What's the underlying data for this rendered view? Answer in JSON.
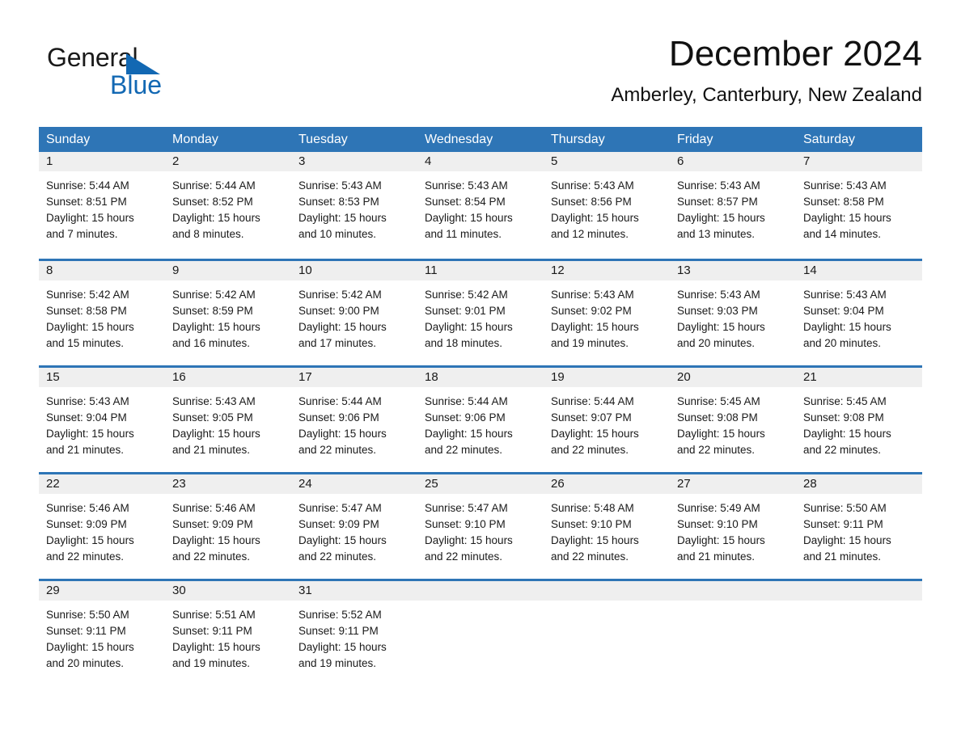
{
  "brand": {
    "name_part1": "General",
    "name_part2": "Blue",
    "logo_icon": "triangle-flag-icon",
    "accent_color": "#1268b3"
  },
  "header": {
    "title": "December 2024",
    "subtitle": "Amberley, Canterbury, New Zealand"
  },
  "theme": {
    "header_blue": "#2e75b6",
    "daynum_band": "#efefef",
    "text": "#1a1a1a"
  },
  "weekdays": [
    "Sunday",
    "Monday",
    "Tuesday",
    "Wednesday",
    "Thursday",
    "Friday",
    "Saturday"
  ],
  "weeks": [
    [
      {
        "day": "1",
        "sunrise": "Sunrise: 5:44 AM",
        "sunset": "Sunset: 8:51 PM",
        "daylight_line1": "Daylight: 15 hours",
        "daylight_line2": "and 7 minutes."
      },
      {
        "day": "2",
        "sunrise": "Sunrise: 5:44 AM",
        "sunset": "Sunset: 8:52 PM",
        "daylight_line1": "Daylight: 15 hours",
        "daylight_line2": "and 8 minutes."
      },
      {
        "day": "3",
        "sunrise": "Sunrise: 5:43 AM",
        "sunset": "Sunset: 8:53 PM",
        "daylight_line1": "Daylight: 15 hours",
        "daylight_line2": "and 10 minutes."
      },
      {
        "day": "4",
        "sunrise": "Sunrise: 5:43 AM",
        "sunset": "Sunset: 8:54 PM",
        "daylight_line1": "Daylight: 15 hours",
        "daylight_line2": "and 11 minutes."
      },
      {
        "day": "5",
        "sunrise": "Sunrise: 5:43 AM",
        "sunset": "Sunset: 8:56 PM",
        "daylight_line1": "Daylight: 15 hours",
        "daylight_line2": "and 12 minutes."
      },
      {
        "day": "6",
        "sunrise": "Sunrise: 5:43 AM",
        "sunset": "Sunset: 8:57 PM",
        "daylight_line1": "Daylight: 15 hours",
        "daylight_line2": "and 13 minutes."
      },
      {
        "day": "7",
        "sunrise": "Sunrise: 5:43 AM",
        "sunset": "Sunset: 8:58 PM",
        "daylight_line1": "Daylight: 15 hours",
        "daylight_line2": "and 14 minutes."
      }
    ],
    [
      {
        "day": "8",
        "sunrise": "Sunrise: 5:42 AM",
        "sunset": "Sunset: 8:58 PM",
        "daylight_line1": "Daylight: 15 hours",
        "daylight_line2": "and 15 minutes."
      },
      {
        "day": "9",
        "sunrise": "Sunrise: 5:42 AM",
        "sunset": "Sunset: 8:59 PM",
        "daylight_line1": "Daylight: 15 hours",
        "daylight_line2": "and 16 minutes."
      },
      {
        "day": "10",
        "sunrise": "Sunrise: 5:42 AM",
        "sunset": "Sunset: 9:00 PM",
        "daylight_line1": "Daylight: 15 hours",
        "daylight_line2": "and 17 minutes."
      },
      {
        "day": "11",
        "sunrise": "Sunrise: 5:42 AM",
        "sunset": "Sunset: 9:01 PM",
        "daylight_line1": "Daylight: 15 hours",
        "daylight_line2": "and 18 minutes."
      },
      {
        "day": "12",
        "sunrise": "Sunrise: 5:43 AM",
        "sunset": "Sunset: 9:02 PM",
        "daylight_line1": "Daylight: 15 hours",
        "daylight_line2": "and 19 minutes."
      },
      {
        "day": "13",
        "sunrise": "Sunrise: 5:43 AM",
        "sunset": "Sunset: 9:03 PM",
        "daylight_line1": "Daylight: 15 hours",
        "daylight_line2": "and 20 minutes."
      },
      {
        "day": "14",
        "sunrise": "Sunrise: 5:43 AM",
        "sunset": "Sunset: 9:04 PM",
        "daylight_line1": "Daylight: 15 hours",
        "daylight_line2": "and 20 minutes."
      }
    ],
    [
      {
        "day": "15",
        "sunrise": "Sunrise: 5:43 AM",
        "sunset": "Sunset: 9:04 PM",
        "daylight_line1": "Daylight: 15 hours",
        "daylight_line2": "and 21 minutes."
      },
      {
        "day": "16",
        "sunrise": "Sunrise: 5:43 AM",
        "sunset": "Sunset: 9:05 PM",
        "daylight_line1": "Daylight: 15 hours",
        "daylight_line2": "and 21 minutes."
      },
      {
        "day": "17",
        "sunrise": "Sunrise: 5:44 AM",
        "sunset": "Sunset: 9:06 PM",
        "daylight_line1": "Daylight: 15 hours",
        "daylight_line2": "and 22 minutes."
      },
      {
        "day": "18",
        "sunrise": "Sunrise: 5:44 AM",
        "sunset": "Sunset: 9:06 PM",
        "daylight_line1": "Daylight: 15 hours",
        "daylight_line2": "and 22 minutes."
      },
      {
        "day": "19",
        "sunrise": "Sunrise: 5:44 AM",
        "sunset": "Sunset: 9:07 PM",
        "daylight_line1": "Daylight: 15 hours",
        "daylight_line2": "and 22 minutes."
      },
      {
        "day": "20",
        "sunrise": "Sunrise: 5:45 AM",
        "sunset": "Sunset: 9:08 PM",
        "daylight_line1": "Daylight: 15 hours",
        "daylight_line2": "and 22 minutes."
      },
      {
        "day": "21",
        "sunrise": "Sunrise: 5:45 AM",
        "sunset": "Sunset: 9:08 PM",
        "daylight_line1": "Daylight: 15 hours",
        "daylight_line2": "and 22 minutes."
      }
    ],
    [
      {
        "day": "22",
        "sunrise": "Sunrise: 5:46 AM",
        "sunset": "Sunset: 9:09 PM",
        "daylight_line1": "Daylight: 15 hours",
        "daylight_line2": "and 22 minutes."
      },
      {
        "day": "23",
        "sunrise": "Sunrise: 5:46 AM",
        "sunset": "Sunset: 9:09 PM",
        "daylight_line1": "Daylight: 15 hours",
        "daylight_line2": "and 22 minutes."
      },
      {
        "day": "24",
        "sunrise": "Sunrise: 5:47 AM",
        "sunset": "Sunset: 9:09 PM",
        "daylight_line1": "Daylight: 15 hours",
        "daylight_line2": "and 22 minutes."
      },
      {
        "day": "25",
        "sunrise": "Sunrise: 5:47 AM",
        "sunset": "Sunset: 9:10 PM",
        "daylight_line1": "Daylight: 15 hours",
        "daylight_line2": "and 22 minutes."
      },
      {
        "day": "26",
        "sunrise": "Sunrise: 5:48 AM",
        "sunset": "Sunset: 9:10 PM",
        "daylight_line1": "Daylight: 15 hours",
        "daylight_line2": "and 22 minutes."
      },
      {
        "day": "27",
        "sunrise": "Sunrise: 5:49 AM",
        "sunset": "Sunset: 9:10 PM",
        "daylight_line1": "Daylight: 15 hours",
        "daylight_line2": "and 21 minutes."
      },
      {
        "day": "28",
        "sunrise": "Sunrise: 5:50 AM",
        "sunset": "Sunset: 9:11 PM",
        "daylight_line1": "Daylight: 15 hours",
        "daylight_line2": "and 21 minutes."
      }
    ],
    [
      {
        "day": "29",
        "sunrise": "Sunrise: 5:50 AM",
        "sunset": "Sunset: 9:11 PM",
        "daylight_line1": "Daylight: 15 hours",
        "daylight_line2": "and 20 minutes."
      },
      {
        "day": "30",
        "sunrise": "Sunrise: 5:51 AM",
        "sunset": "Sunset: 9:11 PM",
        "daylight_line1": "Daylight: 15 hours",
        "daylight_line2": "and 19 minutes."
      },
      {
        "day": "31",
        "sunrise": "Sunrise: 5:52 AM",
        "sunset": "Sunset: 9:11 PM",
        "daylight_line1": "Daylight: 15 hours",
        "daylight_line2": "and 19 minutes."
      },
      {
        "day": "",
        "sunrise": "",
        "sunset": "",
        "daylight_line1": "",
        "daylight_line2": ""
      },
      {
        "day": "",
        "sunrise": "",
        "sunset": "",
        "daylight_line1": "",
        "daylight_line2": ""
      },
      {
        "day": "",
        "sunrise": "",
        "sunset": "",
        "daylight_line1": "",
        "daylight_line2": ""
      },
      {
        "day": "",
        "sunrise": "",
        "sunset": "",
        "daylight_line1": "",
        "daylight_line2": ""
      }
    ]
  ]
}
